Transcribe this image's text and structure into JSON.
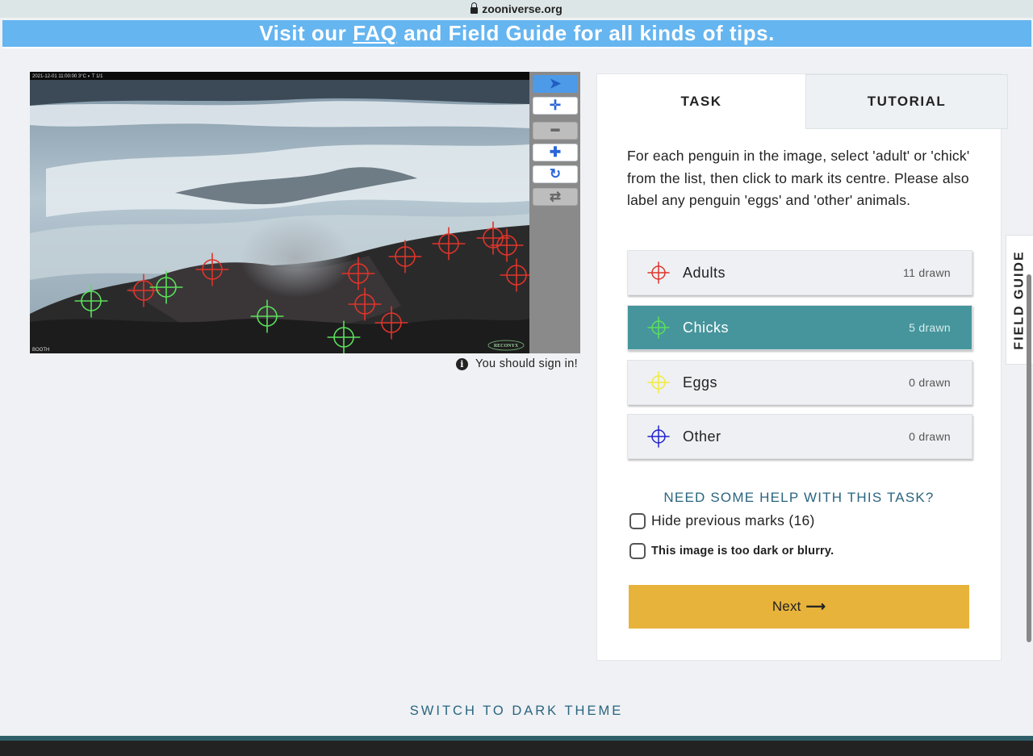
{
  "browser": {
    "url": "zooniverse.org"
  },
  "banner": {
    "text_before": "Visit our",
    "faq_link": "FAQ",
    "text_after": "and Field Guide for all kinds of tips."
  },
  "image": {
    "overlay_text": "2021-12-01 11:00:00    3°C  ◐     T 1/1",
    "corner_left": "BOOTH",
    "corner_right": "RECONYX"
  },
  "toolbar": {
    "tools": [
      "select-pointer",
      "move",
      "zoom-out",
      "zoom-in",
      "rotate",
      "reset"
    ]
  },
  "signin_notice": "You should sign in!",
  "tabs": {
    "task": "TASK",
    "tutorial": "TUTORIAL"
  },
  "task": {
    "instruction": "For each penguin in the image, select 'adult' or 'chick' from the list, then click to mark its centre. Please also label any penguin 'eggs' and 'other' animals.",
    "choices": [
      {
        "label": "Adults",
        "count": "11 drawn",
        "color": "#e0342a",
        "selected": false
      },
      {
        "label": "Chicks",
        "count": "5 drawn",
        "color": "#5be05b",
        "selected": true
      },
      {
        "label": "Eggs",
        "count": "0 drawn",
        "color": "#f2ea3c",
        "selected": false
      },
      {
        "label": "Other",
        "count": "0 drawn",
        "color": "#2222cc",
        "selected": false
      }
    ],
    "help_link": "NEED SOME HELP WITH THIS TASK?",
    "hide_marks": "Hide previous marks (16)",
    "too_dark": "This image is too dark or blurry.",
    "next_button": "Next",
    "next_arrow": "⟶"
  },
  "field_guide": "FIELD GUIDE",
  "theme_toggle": "SWITCH TO DARK THEME"
}
